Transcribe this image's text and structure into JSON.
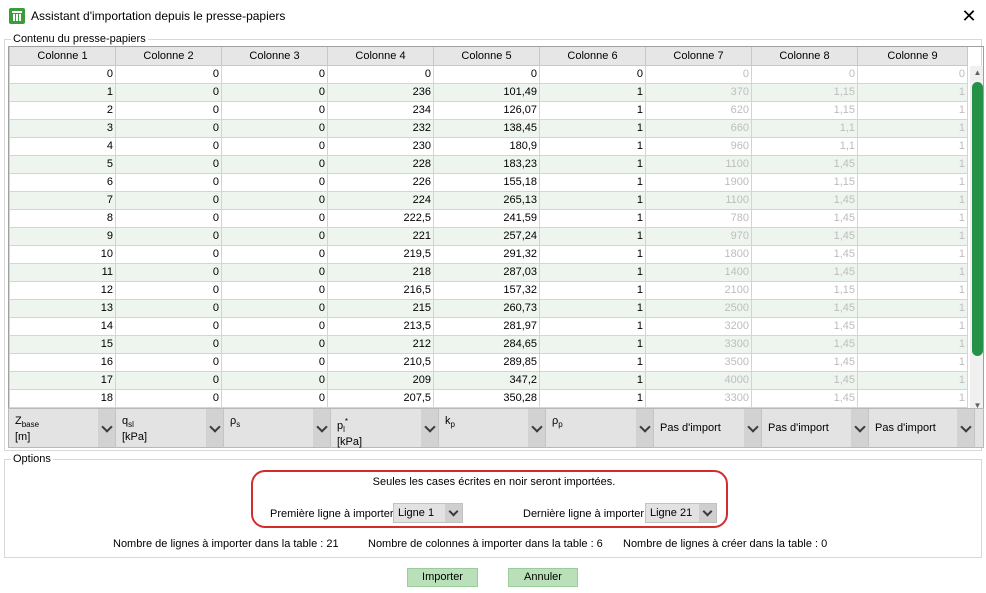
{
  "window": {
    "title": "Assistant d'importation depuis le presse-papiers"
  },
  "clipboard": {
    "legend": "Contenu du presse-papiers",
    "columns": [
      "Colonne 1",
      "Colonne 2",
      "Colonne 3",
      "Colonne 4",
      "Colonne 5",
      "Colonne 6",
      "Colonne 7",
      "Colonne 8",
      "Colonne 9"
    ],
    "rows": [
      [
        "0",
        "0",
        "0",
        "0",
        "0",
        "0",
        "0",
        "0",
        "0"
      ],
      [
        "1",
        "0",
        "0",
        "236",
        "101,49",
        "1",
        "370",
        "1,15",
        "1"
      ],
      [
        "2",
        "0",
        "0",
        "234",
        "126,07",
        "1",
        "620",
        "1,15",
        "1"
      ],
      [
        "3",
        "0",
        "0",
        "232",
        "138,45",
        "1",
        "660",
        "1,1",
        "1"
      ],
      [
        "4",
        "0",
        "0",
        "230",
        "180,9",
        "1",
        "960",
        "1,1",
        "1"
      ],
      [
        "5",
        "0",
        "0",
        "228",
        "183,23",
        "1",
        "1100",
        "1,45",
        "1"
      ],
      [
        "6",
        "0",
        "0",
        "226",
        "155,18",
        "1",
        "1900",
        "1,15",
        "1"
      ],
      [
        "7",
        "0",
        "0",
        "224",
        "265,13",
        "1",
        "1100",
        "1,45",
        "1"
      ],
      [
        "8",
        "0",
        "0",
        "222,5",
        "241,59",
        "1",
        "780",
        "1,45",
        "1"
      ],
      [
        "9",
        "0",
        "0",
        "221",
        "257,24",
        "1",
        "970",
        "1,45",
        "1"
      ],
      [
        "10",
        "0",
        "0",
        "219,5",
        "291,32",
        "1",
        "1800",
        "1,45",
        "1"
      ],
      [
        "11",
        "0",
        "0",
        "218",
        "287,03",
        "1",
        "1400",
        "1,45",
        "1"
      ],
      [
        "12",
        "0",
        "0",
        "216,5",
        "157,32",
        "1",
        "2100",
        "1,15",
        "1"
      ],
      [
        "13",
        "0",
        "0",
        "215",
        "260,73",
        "1",
        "2500",
        "1,45",
        "1"
      ],
      [
        "14",
        "0",
        "0",
        "213,5",
        "281,97",
        "1",
        "3200",
        "1,45",
        "1"
      ],
      [
        "15",
        "0",
        "0",
        "212",
        "284,65",
        "1",
        "3300",
        "1,45",
        "1"
      ],
      [
        "16",
        "0",
        "0",
        "210,5",
        "289,85",
        "1",
        "3500",
        "1,45",
        "1"
      ],
      [
        "17",
        "0",
        "0",
        "209",
        "347,2",
        "1",
        "4000",
        "1,45",
        "1"
      ],
      [
        "18",
        "0",
        "0",
        "207,5",
        "350,28",
        "1",
        "3300",
        "1,45",
        "1"
      ]
    ]
  },
  "mapping": [
    {
      "main": "Z",
      "sub": "base",
      "unit": "[m]"
    },
    {
      "main": "q",
      "sub": "sl",
      "unit": "[kPa]"
    },
    {
      "main": "ρ",
      "sub": "s",
      "unit": ""
    },
    {
      "main": "p",
      "sub": "l",
      "sup": "*",
      "unit": "[kPa]"
    },
    {
      "main": "k",
      "sub": "p",
      "unit": ""
    },
    {
      "main": "ρ",
      "sub": "p",
      "unit": ""
    },
    {
      "main": "Pas d'import"
    },
    {
      "main": "Pas d'import"
    },
    {
      "main": "Pas d'import"
    }
  ],
  "options": {
    "legend": "Options",
    "notice": "Seules les cases écrites en noir seront importées.",
    "first_line_label": "Première ligne à importer",
    "first_line_value": "Ligne 1",
    "last_line_label": "Dernière ligne à importer",
    "last_line_value": "Ligne 21",
    "stat_rows": "Nombre de lignes à importer dans la table : 21",
    "stat_cols": "Nombre de colonnes à importer dans la table : 6",
    "stat_create": "Nombre de lignes à créer dans la table : 0"
  },
  "buttons": {
    "import": "Importer",
    "cancel": "Annuler"
  },
  "colors": {
    "accent_green": "#249146",
    "button_green": "#b9e0b8",
    "highlight_red": "#d32c2c",
    "muted_text": "#bdbdbd"
  }
}
